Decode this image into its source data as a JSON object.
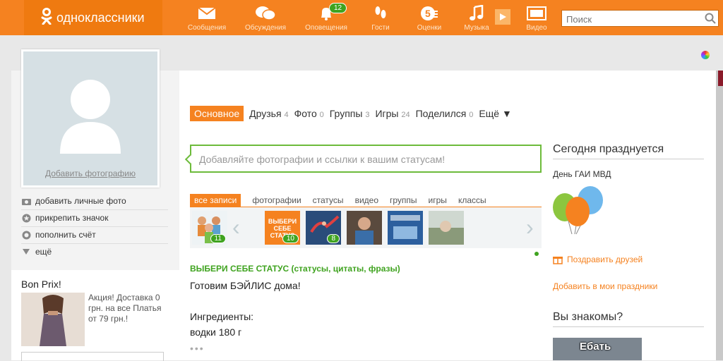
{
  "header": {
    "logo_text": "одноклассники",
    "nav": [
      {
        "label": "Сообщения",
        "icon": "envelope-icon"
      },
      {
        "label": "Обсуждения",
        "icon": "chat-bubbles-icon"
      },
      {
        "label": "Оповещения",
        "icon": "bell-icon",
        "badge": "12"
      },
      {
        "label": "Гости",
        "icon": "footprints-icon"
      },
      {
        "label": "Оценки",
        "icon": "rating-5-icon"
      },
      {
        "label": "Музыка",
        "icon": "music-note-icon"
      },
      {
        "label": "Видео",
        "icon": "video-icon"
      }
    ],
    "search_placeholder": "Поиск"
  },
  "left": {
    "add_photo_link": "Добавить фотографию",
    "menu": [
      {
        "label": "добавить личные фото",
        "icon": "camera-icon"
      },
      {
        "label": "прикрепить значок",
        "icon": "star-badge-icon"
      },
      {
        "label": "пополнить счёт",
        "icon": "coin-icon"
      },
      {
        "label": "ещё",
        "icon": "triangle-down-icon"
      }
    ],
    "ad": {
      "title": "Bon Prix!",
      "text": "Акция! Доставка 0 грн. на все Платья от 79 грн.!"
    }
  },
  "tabs": [
    {
      "label": "Основное",
      "count": ""
    },
    {
      "label": "Друзья",
      "count": "4"
    },
    {
      "label": "Фото",
      "count": "0"
    },
    {
      "label": "Группы",
      "count": "3"
    },
    {
      "label": "Игры",
      "count": "24"
    },
    {
      "label": "Поделился",
      "count": "0"
    },
    {
      "label": "Ещё ▼",
      "count": ""
    }
  ],
  "status_placeholder": "Добавляйте фотографии и ссылки к вашим статусам!",
  "filters": [
    "все записи",
    "фотографии",
    "статусы",
    "видео",
    "группы",
    "игры",
    "классы"
  ],
  "thumbs": [
    {
      "name": "people-group-thumb",
      "count": "11"
    },
    {
      "name": "status-group-thumb",
      "count": "10",
      "text": "ВЫБЕРИ СЕБЕ СТАТУС"
    },
    {
      "name": "dancer-thumb",
      "count": "8"
    },
    {
      "name": "man-portrait-thumb",
      "count": ""
    },
    {
      "name": "game-thumb",
      "count": ""
    },
    {
      "name": "landscape-thumb",
      "count": ""
    }
  ],
  "feed": {
    "group": "ВЫБЕРИ СЕБЕ СТАТУС (статусы, цитаты, фразы)",
    "lines": [
      "Готовим БЭЙЛИС дома!",
      "Ингредиенты:",
      "водки 180 г"
    ],
    "more": "•••"
  },
  "holidays": {
    "title": "Сегодня празднуется",
    "name": "День ГАИ МВД",
    "congrats": "Поздравить друзей",
    "add": "Добавить в мои праздники"
  },
  "know": {
    "title": "Вы знакомы?",
    "img_text": "Ебать"
  },
  "colors": {
    "brand": "#f58220",
    "green": "#3fa31f"
  }
}
